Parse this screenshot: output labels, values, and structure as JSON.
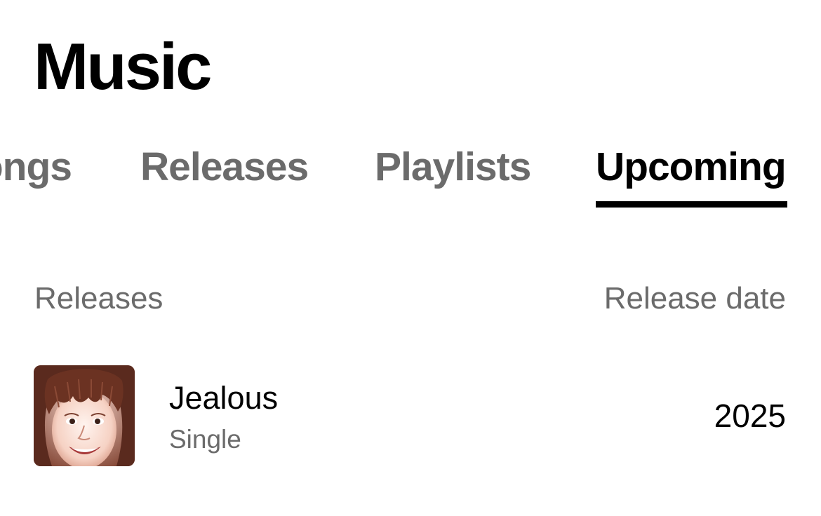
{
  "header": {
    "title": "Music"
  },
  "tabs": [
    {
      "label": "ongs",
      "active": false
    },
    {
      "label": "Releases",
      "active": false
    },
    {
      "label": "Playlists",
      "active": false
    },
    {
      "label": "Upcoming",
      "active": true
    }
  ],
  "list": {
    "column_left": "Releases",
    "column_right": "Release date",
    "items": [
      {
        "title": "Jealous",
        "subtitle": "Single",
        "date": "2025",
        "artwork": "portrait-photo"
      }
    ]
  },
  "colors": {
    "active_tab": "#000000",
    "inactive_tab": "#6b6b6b",
    "secondary_text": "#6b6b6b",
    "background": "#ffffff"
  }
}
